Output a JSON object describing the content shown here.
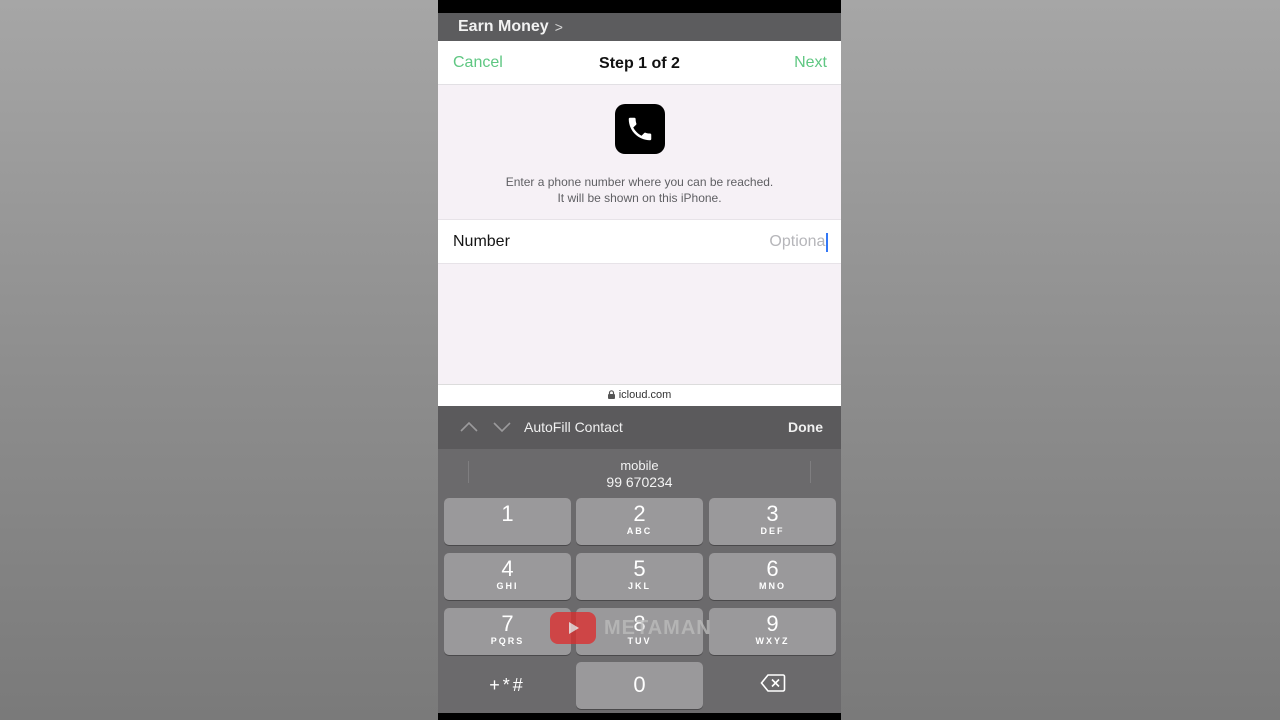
{
  "topbar": {
    "title": "Earn Money",
    "chevron": ">"
  },
  "navbar": {
    "cancel": "Cancel",
    "title": "Step 1 of 2",
    "next": "Next"
  },
  "description": {
    "line1": "Enter a phone number where you can be reached.",
    "line2": "It will be shown on this iPhone."
  },
  "form": {
    "number_label": "Number",
    "number_placeholder": "Optional",
    "number_value": ""
  },
  "urlbar": {
    "domain": "icloud.com"
  },
  "accessory": {
    "autofill": "AutoFill Contact",
    "done": "Done"
  },
  "suggestion": {
    "label": "mobile",
    "value": "99 670234"
  },
  "keypad": {
    "keys": [
      {
        "num": "1",
        "letters": ""
      },
      {
        "num": "2",
        "letters": "ABC"
      },
      {
        "num": "3",
        "letters": "DEF"
      },
      {
        "num": "4",
        "letters": "GHI"
      },
      {
        "num": "5",
        "letters": "JKL"
      },
      {
        "num": "6",
        "letters": "MNO"
      },
      {
        "num": "7",
        "letters": "PQRS"
      },
      {
        "num": "8",
        "letters": "TUV"
      },
      {
        "num": "9",
        "letters": "WXYZ"
      },
      {
        "num": "0",
        "letters": ""
      }
    ],
    "symbols": "+*#"
  },
  "watermark": {
    "text": "METAMAN"
  },
  "colors": {
    "accent_green": "#5fc782",
    "caret_blue": "#3478f6",
    "keyboard_bg": "#6b6a6c",
    "key_bg": "#9a999b"
  },
  "icons": [
    "phone-icon",
    "chevron-right-icon",
    "lock-icon",
    "chevron-up-icon",
    "chevron-down-icon",
    "backspace-icon",
    "play-icon"
  ]
}
